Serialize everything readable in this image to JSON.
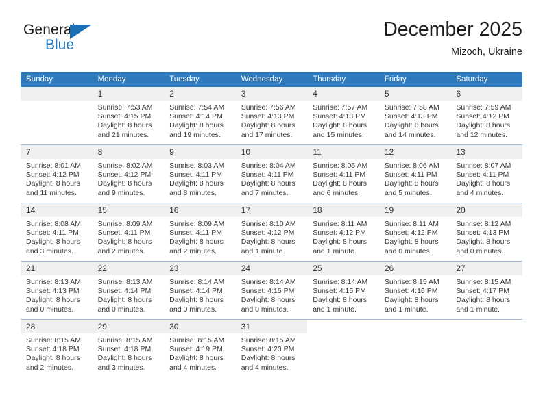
{
  "brand": {
    "name_top": "General",
    "name_bottom": "Blue",
    "accent_color": "#2176bd"
  },
  "header": {
    "title": "December 2025",
    "subtitle": "Mizoch, Ukraine"
  },
  "calendar": {
    "header_color": "#2f79bd",
    "weekday_headers": [
      "Sunday",
      "Monday",
      "Tuesday",
      "Wednesday",
      "Thursday",
      "Friday",
      "Saturday"
    ],
    "weeks": [
      [
        {
          "day": "",
          "sunrise": "",
          "sunset": "",
          "daylight_line1": "",
          "daylight_line2": ""
        },
        {
          "day": "1",
          "sunrise": "Sunrise: 7:53 AM",
          "sunset": "Sunset: 4:15 PM",
          "daylight_line1": "Daylight: 8 hours",
          "daylight_line2": "and 21 minutes."
        },
        {
          "day": "2",
          "sunrise": "Sunrise: 7:54 AM",
          "sunset": "Sunset: 4:14 PM",
          "daylight_line1": "Daylight: 8 hours",
          "daylight_line2": "and 19 minutes."
        },
        {
          "day": "3",
          "sunrise": "Sunrise: 7:56 AM",
          "sunset": "Sunset: 4:13 PM",
          "daylight_line1": "Daylight: 8 hours",
          "daylight_line2": "and 17 minutes."
        },
        {
          "day": "4",
          "sunrise": "Sunrise: 7:57 AM",
          "sunset": "Sunset: 4:13 PM",
          "daylight_line1": "Daylight: 8 hours",
          "daylight_line2": "and 15 minutes."
        },
        {
          "day": "5",
          "sunrise": "Sunrise: 7:58 AM",
          "sunset": "Sunset: 4:13 PM",
          "daylight_line1": "Daylight: 8 hours",
          "daylight_line2": "and 14 minutes."
        },
        {
          "day": "6",
          "sunrise": "Sunrise: 7:59 AM",
          "sunset": "Sunset: 4:12 PM",
          "daylight_line1": "Daylight: 8 hours",
          "daylight_line2": "and 12 minutes."
        }
      ],
      [
        {
          "day": "7",
          "sunrise": "Sunrise: 8:01 AM",
          "sunset": "Sunset: 4:12 PM",
          "daylight_line1": "Daylight: 8 hours",
          "daylight_line2": "and 11 minutes."
        },
        {
          "day": "8",
          "sunrise": "Sunrise: 8:02 AM",
          "sunset": "Sunset: 4:12 PM",
          "daylight_line1": "Daylight: 8 hours",
          "daylight_line2": "and 9 minutes."
        },
        {
          "day": "9",
          "sunrise": "Sunrise: 8:03 AM",
          "sunset": "Sunset: 4:11 PM",
          "daylight_line1": "Daylight: 8 hours",
          "daylight_line2": "and 8 minutes."
        },
        {
          "day": "10",
          "sunrise": "Sunrise: 8:04 AM",
          "sunset": "Sunset: 4:11 PM",
          "daylight_line1": "Daylight: 8 hours",
          "daylight_line2": "and 7 minutes."
        },
        {
          "day": "11",
          "sunrise": "Sunrise: 8:05 AM",
          "sunset": "Sunset: 4:11 PM",
          "daylight_line1": "Daylight: 8 hours",
          "daylight_line2": "and 6 minutes."
        },
        {
          "day": "12",
          "sunrise": "Sunrise: 8:06 AM",
          "sunset": "Sunset: 4:11 PM",
          "daylight_line1": "Daylight: 8 hours",
          "daylight_line2": "and 5 minutes."
        },
        {
          "day": "13",
          "sunrise": "Sunrise: 8:07 AM",
          "sunset": "Sunset: 4:11 PM",
          "daylight_line1": "Daylight: 8 hours",
          "daylight_line2": "and 4 minutes."
        }
      ],
      [
        {
          "day": "14",
          "sunrise": "Sunrise: 8:08 AM",
          "sunset": "Sunset: 4:11 PM",
          "daylight_line1": "Daylight: 8 hours",
          "daylight_line2": "and 3 minutes."
        },
        {
          "day": "15",
          "sunrise": "Sunrise: 8:09 AM",
          "sunset": "Sunset: 4:11 PM",
          "daylight_line1": "Daylight: 8 hours",
          "daylight_line2": "and 2 minutes."
        },
        {
          "day": "16",
          "sunrise": "Sunrise: 8:09 AM",
          "sunset": "Sunset: 4:11 PM",
          "daylight_line1": "Daylight: 8 hours",
          "daylight_line2": "and 2 minutes."
        },
        {
          "day": "17",
          "sunrise": "Sunrise: 8:10 AM",
          "sunset": "Sunset: 4:12 PM",
          "daylight_line1": "Daylight: 8 hours",
          "daylight_line2": "and 1 minute."
        },
        {
          "day": "18",
          "sunrise": "Sunrise: 8:11 AM",
          "sunset": "Sunset: 4:12 PM",
          "daylight_line1": "Daylight: 8 hours",
          "daylight_line2": "and 1 minute."
        },
        {
          "day": "19",
          "sunrise": "Sunrise: 8:11 AM",
          "sunset": "Sunset: 4:12 PM",
          "daylight_line1": "Daylight: 8 hours",
          "daylight_line2": "and 0 minutes."
        },
        {
          "day": "20",
          "sunrise": "Sunrise: 8:12 AM",
          "sunset": "Sunset: 4:13 PM",
          "daylight_line1": "Daylight: 8 hours",
          "daylight_line2": "and 0 minutes."
        }
      ],
      [
        {
          "day": "21",
          "sunrise": "Sunrise: 8:13 AM",
          "sunset": "Sunset: 4:13 PM",
          "daylight_line1": "Daylight: 8 hours",
          "daylight_line2": "and 0 minutes."
        },
        {
          "day": "22",
          "sunrise": "Sunrise: 8:13 AM",
          "sunset": "Sunset: 4:14 PM",
          "daylight_line1": "Daylight: 8 hours",
          "daylight_line2": "and 0 minutes."
        },
        {
          "day": "23",
          "sunrise": "Sunrise: 8:14 AM",
          "sunset": "Sunset: 4:14 PM",
          "daylight_line1": "Daylight: 8 hours",
          "daylight_line2": "and 0 minutes."
        },
        {
          "day": "24",
          "sunrise": "Sunrise: 8:14 AM",
          "sunset": "Sunset: 4:15 PM",
          "daylight_line1": "Daylight: 8 hours",
          "daylight_line2": "and 0 minutes."
        },
        {
          "day": "25",
          "sunrise": "Sunrise: 8:14 AM",
          "sunset": "Sunset: 4:15 PM",
          "daylight_line1": "Daylight: 8 hours",
          "daylight_line2": "and 1 minute."
        },
        {
          "day": "26",
          "sunrise": "Sunrise: 8:15 AM",
          "sunset": "Sunset: 4:16 PM",
          "daylight_line1": "Daylight: 8 hours",
          "daylight_line2": "and 1 minute."
        },
        {
          "day": "27",
          "sunrise": "Sunrise: 8:15 AM",
          "sunset": "Sunset: 4:17 PM",
          "daylight_line1": "Daylight: 8 hours",
          "daylight_line2": "and 1 minute."
        }
      ],
      [
        {
          "day": "28",
          "sunrise": "Sunrise: 8:15 AM",
          "sunset": "Sunset: 4:18 PM",
          "daylight_line1": "Daylight: 8 hours",
          "daylight_line2": "and 2 minutes."
        },
        {
          "day": "29",
          "sunrise": "Sunrise: 8:15 AM",
          "sunset": "Sunset: 4:18 PM",
          "daylight_line1": "Daylight: 8 hours",
          "daylight_line2": "and 3 minutes."
        },
        {
          "day": "30",
          "sunrise": "Sunrise: 8:15 AM",
          "sunset": "Sunset: 4:19 PM",
          "daylight_line1": "Daylight: 8 hours",
          "daylight_line2": "and 4 minutes."
        },
        {
          "day": "31",
          "sunrise": "Sunrise: 8:15 AM",
          "sunset": "Sunset: 4:20 PM",
          "daylight_line1": "Daylight: 8 hours",
          "daylight_line2": "and 4 minutes."
        },
        {
          "day": "",
          "sunrise": "",
          "sunset": "",
          "daylight_line1": "",
          "daylight_line2": ""
        },
        {
          "day": "",
          "sunrise": "",
          "sunset": "",
          "daylight_line1": "",
          "daylight_line2": ""
        },
        {
          "day": "",
          "sunrise": "",
          "sunset": "",
          "daylight_line1": "",
          "daylight_line2": ""
        }
      ]
    ]
  }
}
